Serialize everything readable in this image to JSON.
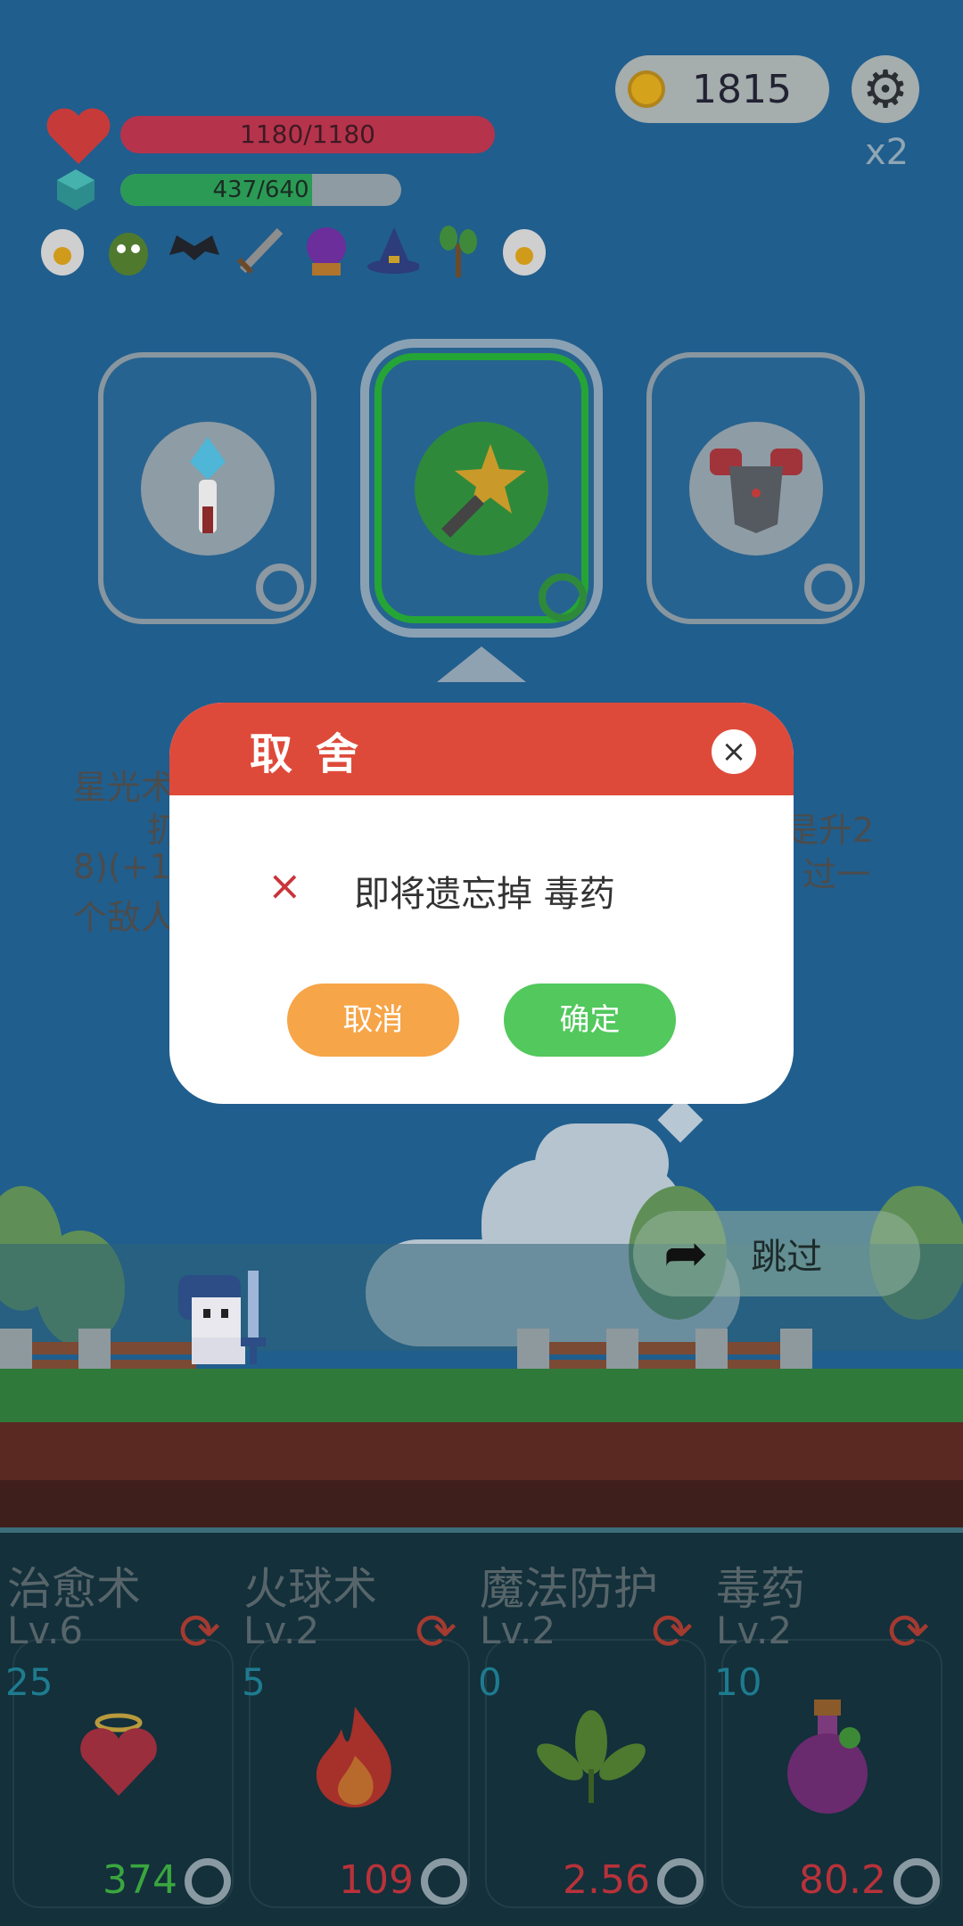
{
  "hud": {
    "coins": "1815",
    "speed_multiplier": "x2",
    "hp_text": "1180/1180",
    "hp_fraction": 1.0,
    "xp_text": "437/640",
    "xp_fraction": 0.683,
    "buff_icons": [
      "egg-icon",
      "slime-icon",
      "bat-icon",
      "sword-icon",
      "crystal-ball-icon",
      "wizard-hat-icon",
      "sapling-icon",
      "egg-icon"
    ]
  },
  "choices": [
    {
      "icon": "ice-staff-icon",
      "selected": false
    },
    {
      "icon": "star-wand-icon",
      "selected": true
    },
    {
      "icon": "armor-icon",
      "selected": false
    }
  ],
  "description": {
    "line1_left": "星光术",
    "line2_left": "扔",
    "line2_right": "是升2",
    "line3_left": "8)(+1",
    "line3_right": "过一",
    "line4_left": "个敌人"
  },
  "modal": {
    "title": "取舍",
    "close": "×",
    "x_mark": "×",
    "message": "即将遗忘掉 毒药",
    "cancel_label": "取消",
    "confirm_label": "确定"
  },
  "skip": {
    "label": "跳过"
  },
  "skills": [
    {
      "name": "治愈术",
      "level": "Lv.6",
      "count": "25",
      "value": "374",
      "value_color": "#3aa63e",
      "icon": "heart-halo-icon"
    },
    {
      "name": "火球术",
      "level": "Lv.2",
      "count": "5",
      "value": "109",
      "value_color": "#b8323a",
      "icon": "fire-icon"
    },
    {
      "name": "魔法防护",
      "level": "Lv.2",
      "count": "0",
      "value": "2.56",
      "value_color": "#b8323a",
      "icon": "leaf-icon"
    },
    {
      "name": "毒药",
      "level": "Lv.2",
      "count": "10",
      "value": "80.2",
      "value_color": "#b8323a",
      "icon": "poison-potion-icon"
    }
  ]
}
